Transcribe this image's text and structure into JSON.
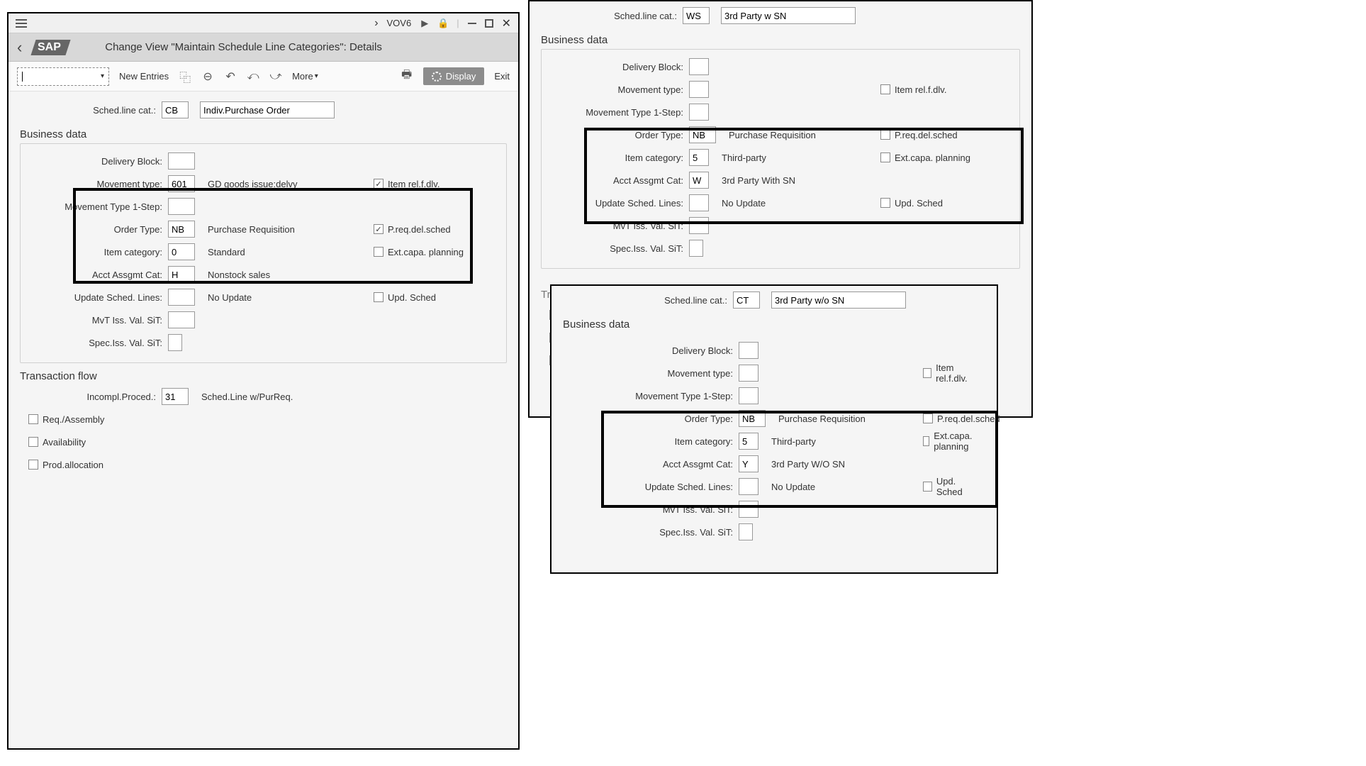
{
  "titlebar": {
    "tcode": "VOV6"
  },
  "header": {
    "sap": "SAP",
    "title": "Change View \"Maintain Schedule Line Categories\": Details"
  },
  "toolbar": {
    "newEntries": "New Entries",
    "more": "More",
    "display": "Display",
    "exit": "Exit"
  },
  "labels": {
    "schedLineCat": "Sched.line cat.:",
    "businessData": "Business data",
    "deliveryBlock": "Delivery Block:",
    "movementType": "Movement type:",
    "movementType1Step": "Movement Type 1-Step:",
    "orderType": "Order Type:",
    "itemCategory": "Item category:",
    "acctAssgmtCat": "Acct Assgmt Cat:",
    "updateSchedLines": "Update Sched. Lines:",
    "mvtIssValSit": "MvT Iss. Val. SiT:",
    "specIssValSit": "Spec.Iss. Val. SiT:",
    "transactionFlow": "Transaction flow",
    "incomplProced": "Incompl.Proced.:"
  },
  "cks": {
    "itemRel": "Item rel.f.dlv.",
    "preq": "P.req.del.sched",
    "extCapa": "Ext.capa. planning",
    "updSched": "Upd. Sched",
    "reqAssembly": "Req./Assembly",
    "availability": "Availability",
    "prodAlloc": "Prod.allocation"
  },
  "left": {
    "cat": "CB",
    "catDesc": "Indiv.Purchase Order",
    "mvt": "601",
    "mvtDesc": "GD goods issue:delvy",
    "orderType": "NB",
    "orderTypeDesc": "Purchase Requisition",
    "itemCat": "0",
    "itemCatDesc": "Standard",
    "acct": "H",
    "acctDesc": "Nonstock sales",
    "updDesc": "No Update",
    "incompl": "31",
    "incomplDesc": "Sched.Line w/PurReq."
  },
  "rightTop": {
    "cat": "WS",
    "catDesc": "3rd Party w SN",
    "orderType": "NB",
    "orderTypeDesc": "Purchase Requisition",
    "itemCat": "5",
    "itemCatDesc": "Third-party",
    "acct": "W",
    "acctDesc": "3rd Party With SN",
    "updDesc": "No Update"
  },
  "rightBot": {
    "cat": "CT",
    "catDesc": "3rd Party w/o SN",
    "orderType": "NB",
    "orderTypeDesc": "Purchase Requisition",
    "itemCat": "5",
    "itemCatDesc": "Third-party",
    "acct": "Y",
    "acctDesc": "3rd Party W/O SN",
    "updDesc": "No Update"
  }
}
